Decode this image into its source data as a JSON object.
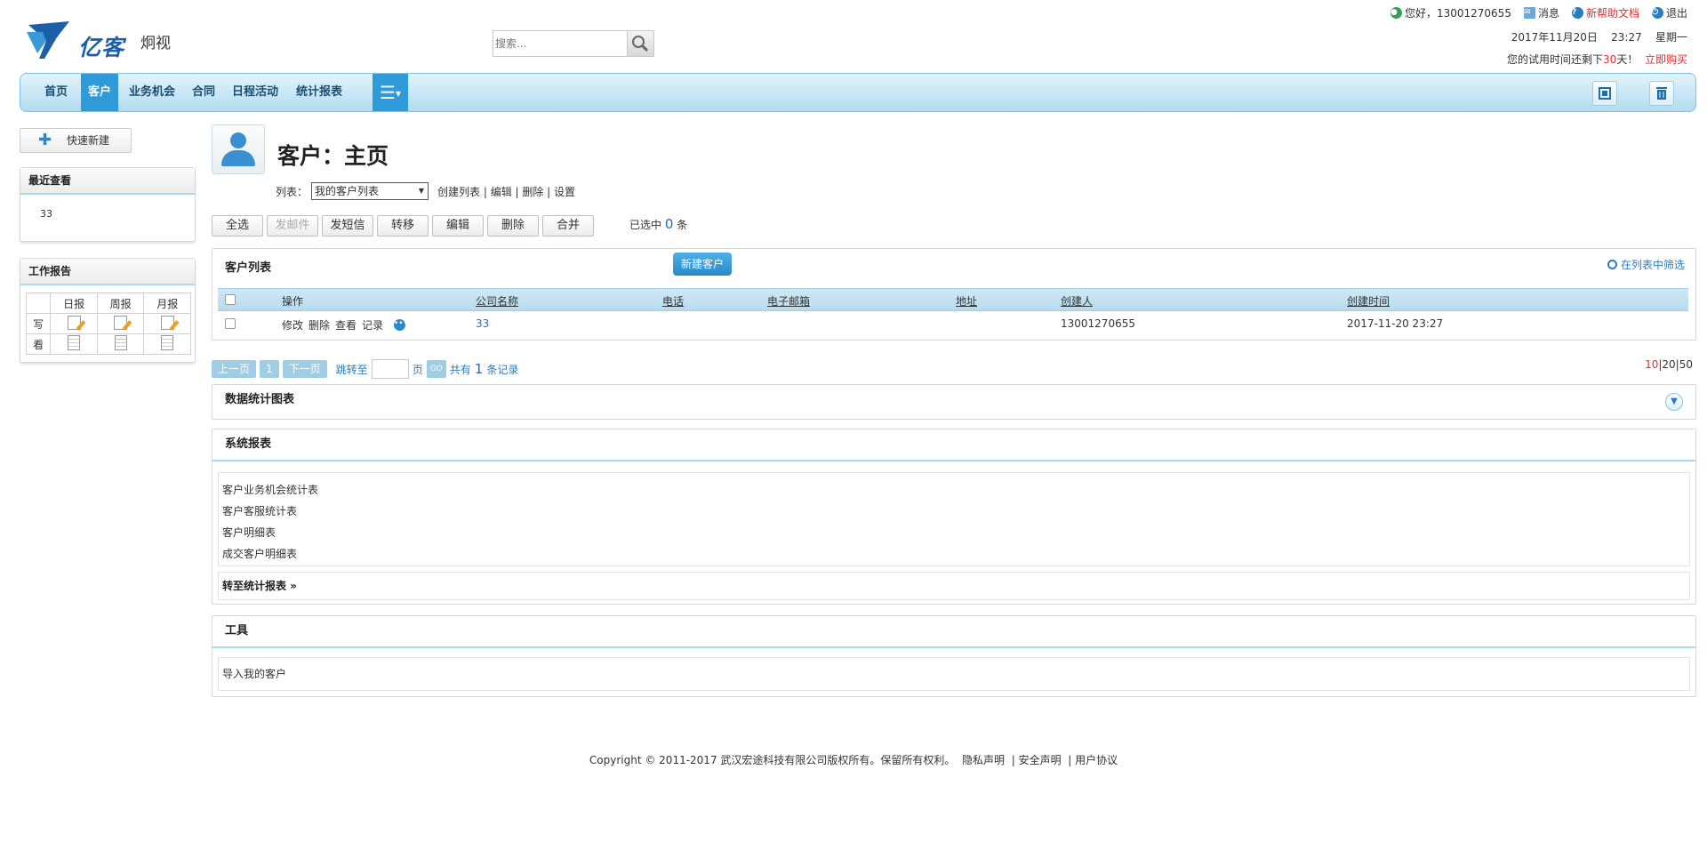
{
  "header": {
    "company": "炯视",
    "brand": "亿客",
    "search_placeholder": "搜索...",
    "greeting": "您好，13001270655",
    "messages": "消息",
    "help": "新帮助文档",
    "logout": "退出",
    "date": "2017年11月20日",
    "time": "23:27",
    "weekday": "星期一",
    "trial_prefix": "您的试用时间还剩下",
    "trial_days": "30",
    "trial_suffix": "天！",
    "buy_now": "立即购买"
  },
  "nav": {
    "items": [
      "首页",
      "客户",
      "业务机会",
      "合同",
      "日程活动",
      "统计报表"
    ],
    "active": "客户",
    "menu_icon": "menu-icon"
  },
  "left": {
    "quick_new": "快速新建",
    "recent_title": "最近查看",
    "recent_items": [
      "33"
    ],
    "report_title": "工作报告",
    "report_cols": [
      "日报",
      "周报",
      "月报"
    ],
    "report_rows": [
      "写",
      "看"
    ]
  },
  "main": {
    "title": "客户：主页",
    "list_label": "列表：",
    "list_selected": "我的客户列表",
    "list_links": "创建列表 | 编辑 | 删除 | 设置",
    "actions": [
      "全选",
      "发邮件",
      "发短信",
      "转移",
      "编辑",
      "删除",
      "合并"
    ],
    "selected_prefix": "已选中",
    "selected_count": "0",
    "selected_suffix": "条",
    "customer_list_title": "客户列表",
    "new_customer": "新建客户",
    "filter_in_list": "在列表中筛选",
    "columns": [
      "操作",
      "公司名称",
      "电话",
      "电子邮箱",
      "地址",
      "创建人",
      "创建时间"
    ],
    "rows": [
      {
        "ops": [
          "修改",
          "删除",
          "查看",
          "记录"
        ],
        "company": "33",
        "phone": "",
        "email": "",
        "address": "",
        "creator": "13001270655",
        "created": "2017-11-20 23:27"
      }
    ],
    "pager": {
      "prev": "上一页",
      "page": "1",
      "next": "下一页",
      "jump_to": "跳转至",
      "page_unit": "页",
      "go": "GO",
      "total_prefix": "共有",
      "total": "1",
      "total_suffix": "条记录"
    },
    "page_sizes": [
      "10",
      "20",
      "50"
    ],
    "page_size_active": "10"
  },
  "sections": {
    "chart_title": "数据统计图表",
    "system_title": "系统报表",
    "system_items": [
      "客户业务机会统计表",
      "客户客服统计表",
      "客户明细表",
      "成交客户明细表"
    ],
    "goto_reports": "转至统计报表 »",
    "tools_title": "工具",
    "tools_items": [
      "导入我的客户"
    ]
  },
  "footer": {
    "copyright": "Copyright © 2011-2017 武汉宏途科技有限公司版权所有。保留所有权利。",
    "privacy": "隐私声明",
    "security": "安全声明",
    "agreement": "用户协议"
  },
  "colors": {
    "accent": "#2e9ad7",
    "nav_bg": "#c6e6f6",
    "link": "#2a7cc0",
    "alert": "#e03030"
  }
}
